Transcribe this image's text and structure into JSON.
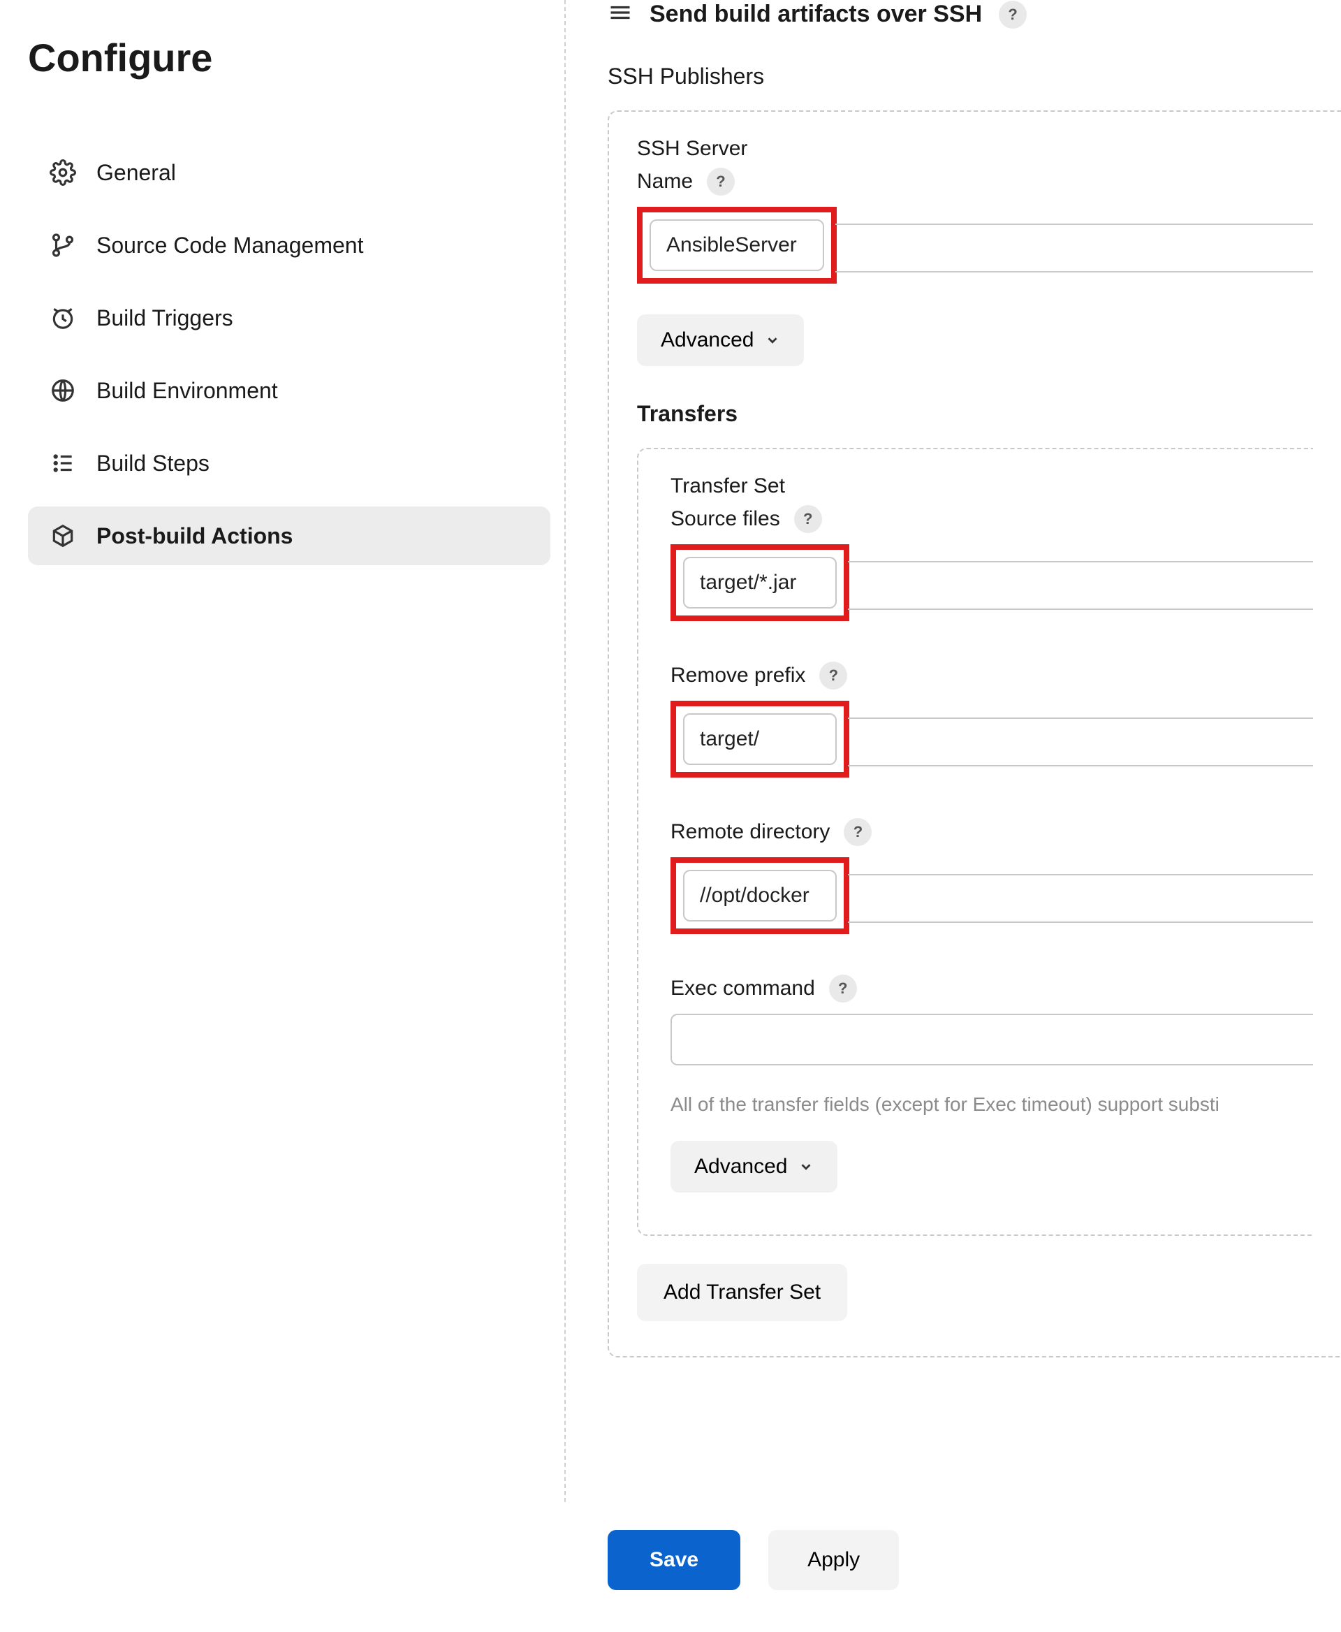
{
  "page_title": "Configure",
  "nav": {
    "items": [
      {
        "label": "General",
        "icon": "gear-icon"
      },
      {
        "label": "Source Code Management",
        "icon": "branch-icon"
      },
      {
        "label": "Build Triggers",
        "icon": "clock-icon"
      },
      {
        "label": "Build Environment",
        "icon": "globe-icon"
      },
      {
        "label": "Build Steps",
        "icon": "steps-icon"
      },
      {
        "label": "Post-build Actions",
        "icon": "package-icon"
      }
    ],
    "active_index": 5
  },
  "section": {
    "title": "Send build artifacts over SSH",
    "publishers_label": "SSH Publishers",
    "ssh_server_heading": "SSH Server",
    "name_label": "Name",
    "name_value": "AnsibleServer",
    "advanced_label": "Advanced",
    "transfers_label": "Transfers",
    "transfer_set_heading": "Transfer Set",
    "source_files_label": "Source files",
    "source_files_value": "target/*.jar",
    "remove_prefix_label": "Remove prefix",
    "remove_prefix_value": "target/",
    "remote_dir_label": "Remote directory",
    "remote_dir_value": "//opt/docker",
    "exec_command_label": "Exec command",
    "exec_command_value": "",
    "hint": "All of the transfer fields (except for Exec timeout) support substi",
    "add_transfer_set_label": "Add Transfer Set"
  },
  "footer": {
    "save": "Save",
    "apply": "Apply"
  }
}
